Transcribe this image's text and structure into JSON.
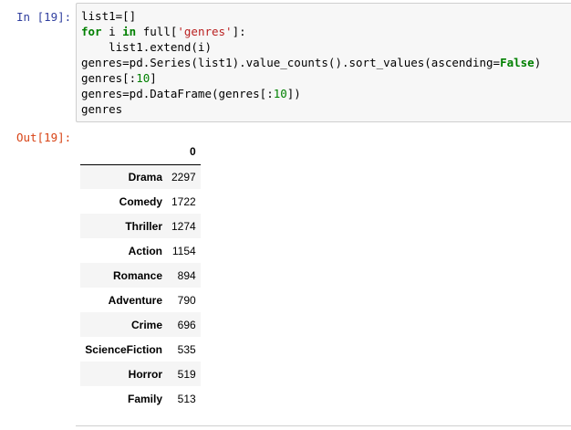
{
  "cell": {
    "in_prompt": "In [19]:",
    "out_prompt": "Out[19]:",
    "code_lines": [
      [
        {
          "t": "list1=[]",
          "c": ""
        }
      ],
      [
        {
          "t": "for",
          "c": "kw"
        },
        {
          "t": " i ",
          "c": ""
        },
        {
          "t": "in",
          "c": "kw"
        },
        {
          "t": " full[",
          "c": ""
        },
        {
          "t": "'genres'",
          "c": "str"
        },
        {
          "t": "]:",
          "c": ""
        }
      ],
      [
        {
          "t": "    list1.extend(i)",
          "c": ""
        }
      ],
      [
        {
          "t": "genres=pd.Series(list1).value_counts().sort_values(ascending=",
          "c": ""
        },
        {
          "t": "False",
          "c": "kw"
        },
        {
          "t": ")",
          "c": ""
        }
      ],
      [
        {
          "t": "genres[:",
          "c": ""
        },
        {
          "t": "10",
          "c": "num"
        },
        {
          "t": "]",
          "c": ""
        }
      ],
      [
        {
          "t": "genres=pd.DataFrame(genres[:",
          "c": ""
        },
        {
          "t": "10",
          "c": "num"
        },
        {
          "t": "])",
          "c": ""
        }
      ],
      [
        {
          "t": "genres",
          "c": ""
        }
      ]
    ]
  },
  "output_table": {
    "index_header": "",
    "column_header": "0",
    "rows": [
      {
        "label": "Drama",
        "value": "2297"
      },
      {
        "label": "Comedy",
        "value": "1722"
      },
      {
        "label": "Thriller",
        "value": "1274"
      },
      {
        "label": "Action",
        "value": "1154"
      },
      {
        "label": "Romance",
        "value": "894"
      },
      {
        "label": "Adventure",
        "value": "790"
      },
      {
        "label": "Crime",
        "value": "696"
      },
      {
        "label": "ScienceFiction",
        "value": "535"
      },
      {
        "label": "Horror",
        "value": "519"
      },
      {
        "label": "Family",
        "value": "513"
      }
    ]
  },
  "colors": {
    "in_prompt": "#303F9F",
    "out_prompt": "#D84315",
    "keyword": "#008000",
    "string": "#BA2121",
    "number": "#008000"
  }
}
